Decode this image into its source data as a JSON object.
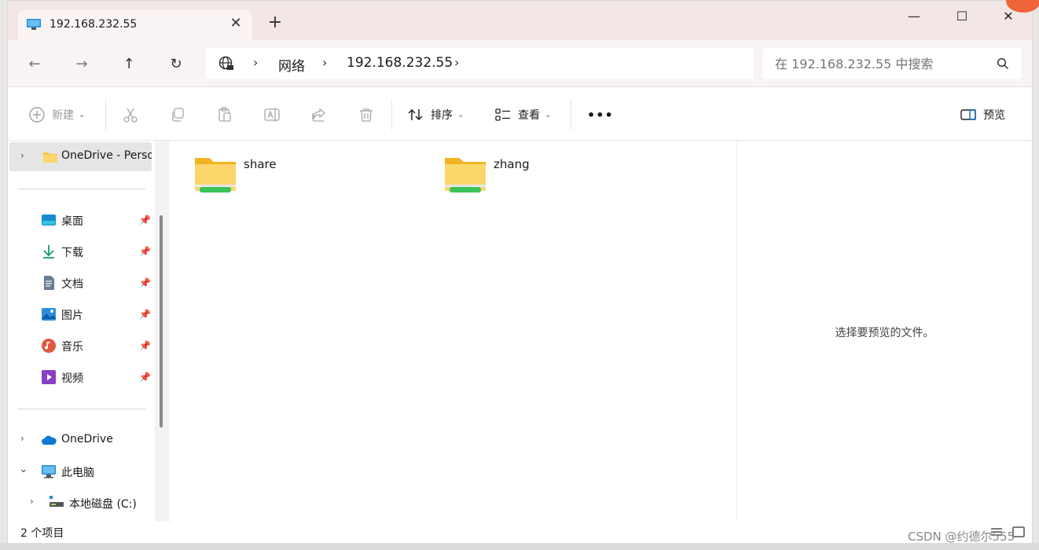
{
  "tab": {
    "title": "192.168.232.55",
    "icon": "computer-icon"
  },
  "window_controls": {
    "minimize": "—",
    "maximize": "☐",
    "close": "✕"
  },
  "nav": {
    "back": "←",
    "forward": "→",
    "up": "↑",
    "refresh": "↻"
  },
  "breadcrumb": {
    "root": "网络",
    "host": "192.168.232.55"
  },
  "search": {
    "placeholder": "在 192.168.232.55 中搜索"
  },
  "commands": {
    "new": "新建",
    "sort": "排序",
    "view": "查看",
    "more": "•••",
    "preview": "预览"
  },
  "sidebar": {
    "onedrive_personal": "OneDrive - Perso",
    "quick_access": [
      {
        "label": "桌面",
        "icon": "desktop-icon"
      },
      {
        "label": "下载",
        "icon": "download-icon"
      },
      {
        "label": "文档",
        "icon": "document-icon"
      },
      {
        "label": "图片",
        "icon": "picture-icon"
      },
      {
        "label": "音乐",
        "icon": "music-icon"
      },
      {
        "label": "视频",
        "icon": "video-icon"
      }
    ],
    "onedrive": "OneDrive",
    "this_pc": "此电脑",
    "local_disk": "本地磁盘 (C:)"
  },
  "folders": [
    {
      "name": "share"
    },
    {
      "name": "zhang"
    }
  ],
  "preview_pane": {
    "message": "选择要预览的文件。"
  },
  "status": {
    "count": "2 个项目"
  },
  "watermark": "CSDN @约德尔555",
  "colors": {
    "accent": "#0067c0",
    "folder": "#f9c638",
    "share_bar": "#3cc25a"
  }
}
